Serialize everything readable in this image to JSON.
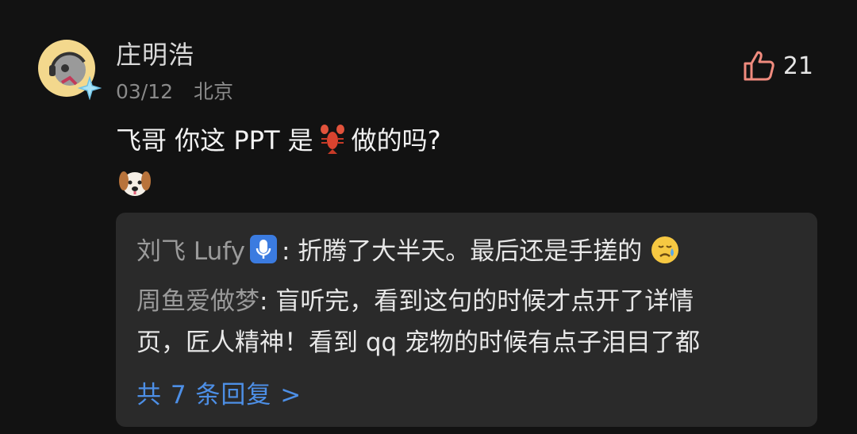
{
  "comment": {
    "username": "庄明浩",
    "date": "03/12",
    "location": "北京",
    "likes": "21",
    "text_part1": "飞哥 你这 PPT 是",
    "text_part2": "做的吗?",
    "emoji_inline": "lobster-emoji",
    "emoji_line": "dog-face-emoji"
  },
  "replies": [
    {
      "name": "刘飞 Lufy",
      "badge": "microphone-badge",
      "text": ": 折腾了大半天。最后还是手搓的",
      "emoji": "crying-face-emoji"
    },
    {
      "name": "周鱼爱做梦",
      "text_line1": ": 盲听完，看到这句的时候才点开了详情",
      "text_line2": "页，匠人精神！看到 qq 宠物的时候有点子泪目了都"
    }
  ],
  "more_replies_label": "共 7 条回复 >"
}
